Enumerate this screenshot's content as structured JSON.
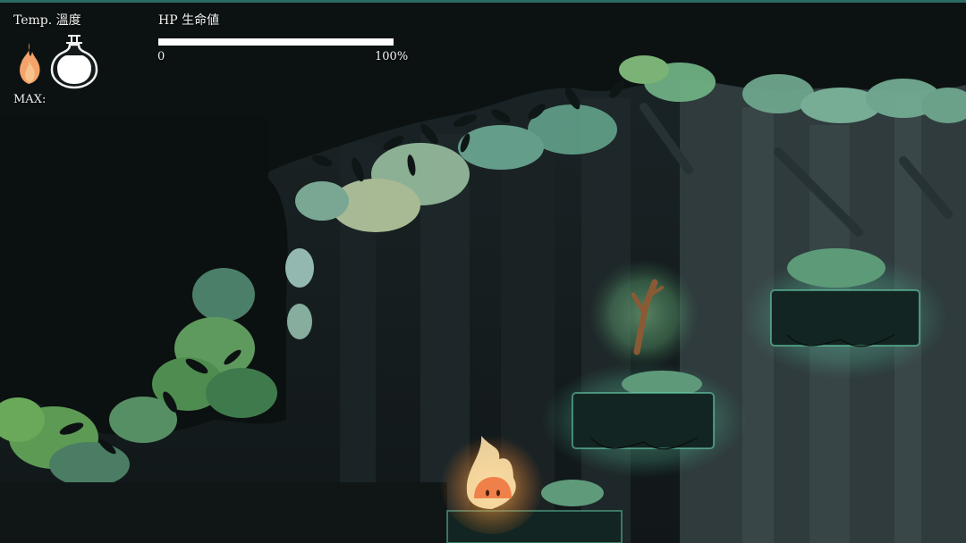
{
  "hud": {
    "temp_label": "Temp. 溫度",
    "max_label": "MAX:",
    "hp_label": "HP 生命値",
    "hp_min_label": "0",
    "hp_max_label": "100%",
    "hp_fraction": 1.0,
    "icons": [
      "flame-icon",
      "flask-icon"
    ]
  },
  "scene": {
    "setting": "dark forest",
    "platforms": 3,
    "pickup_icon": "twig-icon",
    "player_icon": "fire-spirit-icon"
  },
  "colors": {
    "hp_bar": "#ffffff",
    "hud_text": "#f2f2f2",
    "glow": "#6ee0b4",
    "fire": "#ffa040",
    "player_body": "#f0804a",
    "background": "#141a1b"
  }
}
